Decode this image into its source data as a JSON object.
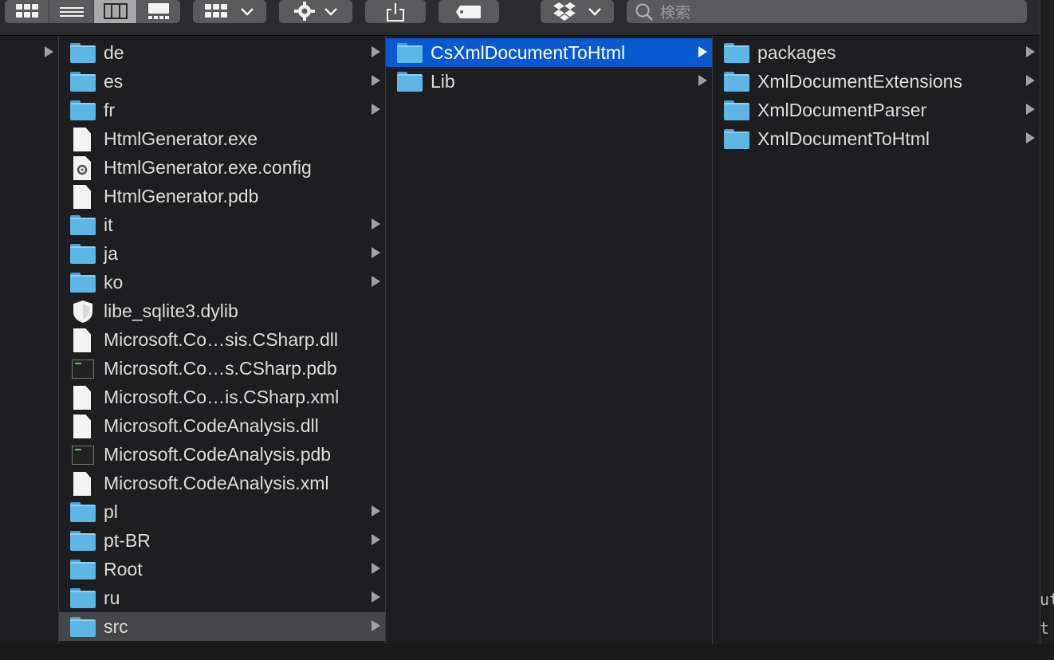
{
  "toolbar": {
    "view_buttons": [
      "icon-view",
      "list-view",
      "column-view",
      "gallery-view"
    ],
    "search_placeholder": "検索"
  },
  "columns": [
    {
      "name": "parent",
      "items": [
        {
          "label": "",
          "type": "parent",
          "arrow": true
        }
      ]
    },
    {
      "name": "col2",
      "items": [
        {
          "label": "de",
          "type": "folder",
          "arrow": true
        },
        {
          "label": "es",
          "type": "folder",
          "arrow": true
        },
        {
          "label": "fr",
          "type": "folder",
          "arrow": true
        },
        {
          "label": "HtmlGenerator.exe",
          "type": "doc",
          "arrow": false
        },
        {
          "label": "HtmlGenerator.exe.config",
          "type": "gear",
          "arrow": false
        },
        {
          "label": "HtmlGenerator.pdb",
          "type": "doc",
          "arrow": false
        },
        {
          "label": "it",
          "type": "folder",
          "arrow": true
        },
        {
          "label": "ja",
          "type": "folder",
          "arrow": true
        },
        {
          "label": "ko",
          "type": "folder",
          "arrow": true
        },
        {
          "label": "libe_sqlite3.dylib",
          "type": "shield",
          "arrow": false
        },
        {
          "label": "Microsoft.Co…sis.CSharp.dll",
          "type": "doc",
          "arrow": false
        },
        {
          "label": "Microsoft.Co…s.CSharp.pdb",
          "type": "term",
          "arrow": false
        },
        {
          "label": "Microsoft.Co…is.CSharp.xml",
          "type": "doc",
          "arrow": false
        },
        {
          "label": "Microsoft.CodeAnalysis.dll",
          "type": "doc",
          "arrow": false
        },
        {
          "label": "Microsoft.CodeAnalysis.pdb",
          "type": "term",
          "arrow": false
        },
        {
          "label": "Microsoft.CodeAnalysis.xml",
          "type": "doc",
          "arrow": false
        },
        {
          "label": "pl",
          "type": "folder",
          "arrow": true
        },
        {
          "label": "pt-BR",
          "type": "folder",
          "arrow": true
        },
        {
          "label": "Root",
          "type": "folder",
          "arrow": true
        },
        {
          "label": "ru",
          "type": "folder",
          "arrow": true
        },
        {
          "label": "src",
          "type": "folder",
          "arrow": true,
          "selected": "gray"
        }
      ]
    },
    {
      "name": "col3",
      "items": [
        {
          "label": "CsXmlDocumentToHtml",
          "type": "folder",
          "arrow": true,
          "selected": "blue"
        },
        {
          "label": "Lib",
          "type": "folder",
          "arrow": true
        }
      ]
    },
    {
      "name": "col4",
      "items": [
        {
          "label": "packages",
          "type": "folder",
          "arrow": true
        },
        {
          "label": "XmlDocumentExtensions",
          "type": "folder",
          "arrow": true
        },
        {
          "label": "XmlDocumentParser",
          "type": "folder",
          "arrow": true
        },
        {
          "label": "XmlDocumentToHtml",
          "type": "folder",
          "arrow": true
        }
      ]
    }
  ],
  "side_text": [
    "ut",
    "t"
  ]
}
